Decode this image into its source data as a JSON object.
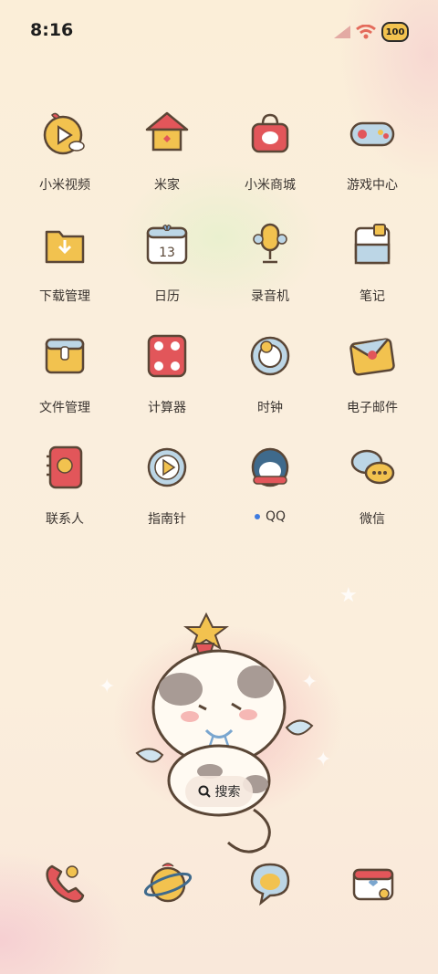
{
  "status_bar": {
    "time": "8:16",
    "battery": "100"
  },
  "apps": [
    {
      "label": "小米视频"
    },
    {
      "label": "米家"
    },
    {
      "label": "小米商城"
    },
    {
      "label": "游戏中心"
    },
    {
      "label": "下载管理"
    },
    {
      "label": "日历",
      "date": "13"
    },
    {
      "label": "录音机"
    },
    {
      "label": "笔记"
    },
    {
      "label": "文件管理"
    },
    {
      "label": "计算器"
    },
    {
      "label": "时钟"
    },
    {
      "label": "电子邮件"
    },
    {
      "label": "联系人"
    },
    {
      "label": "指南针"
    },
    {
      "label": "QQ"
    },
    {
      "label": "微信"
    }
  ],
  "search": {
    "label": "搜索"
  },
  "colors": {
    "accent_yellow": "#f2c24f",
    "accent_red": "#e2565a",
    "notification_dot": "#3d7be0"
  }
}
